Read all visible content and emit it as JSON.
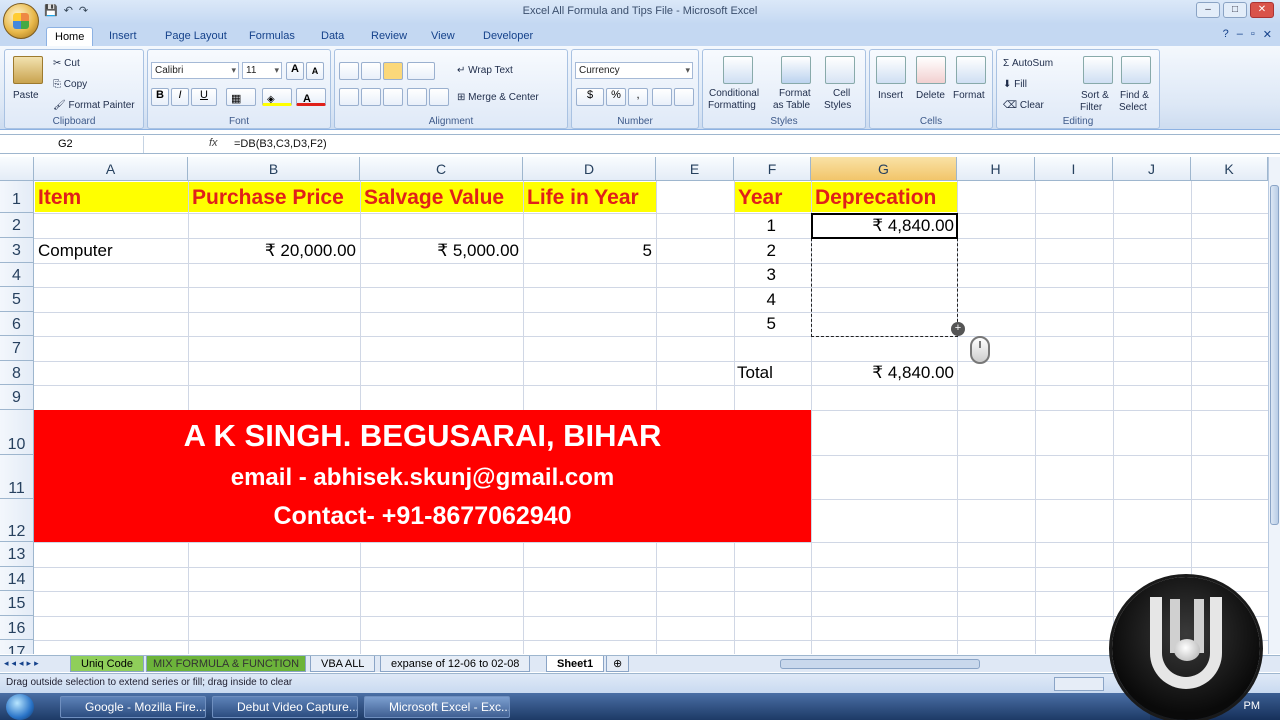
{
  "window": {
    "title": "Excel All Formula and Tips File - Microsoft Excel",
    "controls": [
      "–",
      "□",
      "✕"
    ]
  },
  "ribbon_tabs": [
    "Home",
    "Insert",
    "Page Layout",
    "Formulas",
    "Data",
    "Review",
    "View",
    "Developer"
  ],
  "ribbon": {
    "clipboard": {
      "label": "Clipboard",
      "paste": "Paste",
      "cut": "Cut",
      "copy": "Copy",
      "format_painter": "Format Painter"
    },
    "font": {
      "label": "Font",
      "font_name": "Calibri",
      "font_size": "11",
      "bold": "B",
      "italic": "I",
      "underline": "U"
    },
    "alignment": {
      "label": "Alignment",
      "wrap_text": "Wrap Text",
      "merge_center": "Merge & Center"
    },
    "number": {
      "label": "Number",
      "format": "Currency",
      "dollar": "$",
      "percent": "%",
      "comma": ","
    },
    "styles": {
      "label": "Styles",
      "conditional": "Conditional",
      "conditional2": "Formatting",
      "format_as": "Format",
      "format_as2": "as Table",
      "cell": "Cell",
      "cell2": "Styles"
    },
    "cells": {
      "label": "Cells",
      "insert": "Insert",
      "delete": "Delete",
      "format": "Format"
    },
    "editing": {
      "label": "Editing",
      "autosum": "AutoSum",
      "fill": "Fill",
      "clear": "Clear",
      "sort": "Sort &",
      "sort2": "Filter",
      "find": "Find &",
      "find2": "Select"
    }
  },
  "formula_bar": {
    "name_box": "G2",
    "fx": "fx",
    "formula": "=DB(B3,C3,D3,F2)"
  },
  "columns": [
    "A",
    "B",
    "C",
    "D",
    "E",
    "F",
    "G",
    "H",
    "I",
    "J",
    "K"
  ],
  "rows": [
    "1",
    "2",
    "3",
    "4",
    "5",
    "6",
    "7",
    "8",
    "9",
    "10",
    "11",
    "12",
    "13",
    "14",
    "15",
    "16",
    "17"
  ],
  "sheet": {
    "headers": {
      "item": "Item",
      "purchase_price": "Purchase Price",
      "salvage_value": "Salvage Value",
      "life": "Life in Year",
      "year": "Year",
      "depreciation": "Deprecation"
    },
    "row3": {
      "item": "Computer",
      "purchase_price": "₹  20,000.00",
      "salvage_value": "₹  5,000.00",
      "life": "5"
    },
    "years": [
      "1",
      "2",
      "3",
      "4",
      "5"
    ],
    "g2": "₹  4,840.00",
    "total_label": "Total",
    "total_value": "₹  4,840.00"
  },
  "banner": {
    "line1": "A K SINGH. BEGUSARAI, BIHAR",
    "line2": "email - abhisek.skunj@gmail.com",
    "line3": "Contact- +91-8677062940"
  },
  "sheet_tabs": [
    "Uniq Code",
    "MIX FORMULA & FUNCTION",
    "VBA ALL",
    "expanse of 12-06 to 02-08",
    "Sheet1"
  ],
  "status_text": "Drag outside selection to extend series or fill; drag inside to clear",
  "taskbar": {
    "items": [
      "Google - Mozilla Fire...",
      "Debut Video Capture...",
      "Microsoft Excel - Exc..."
    ],
    "clock": "PM"
  },
  "colors": {
    "header_fill": "#ffff00",
    "header_text": "#e0201a",
    "banner_fill": "#ff0000"
  }
}
